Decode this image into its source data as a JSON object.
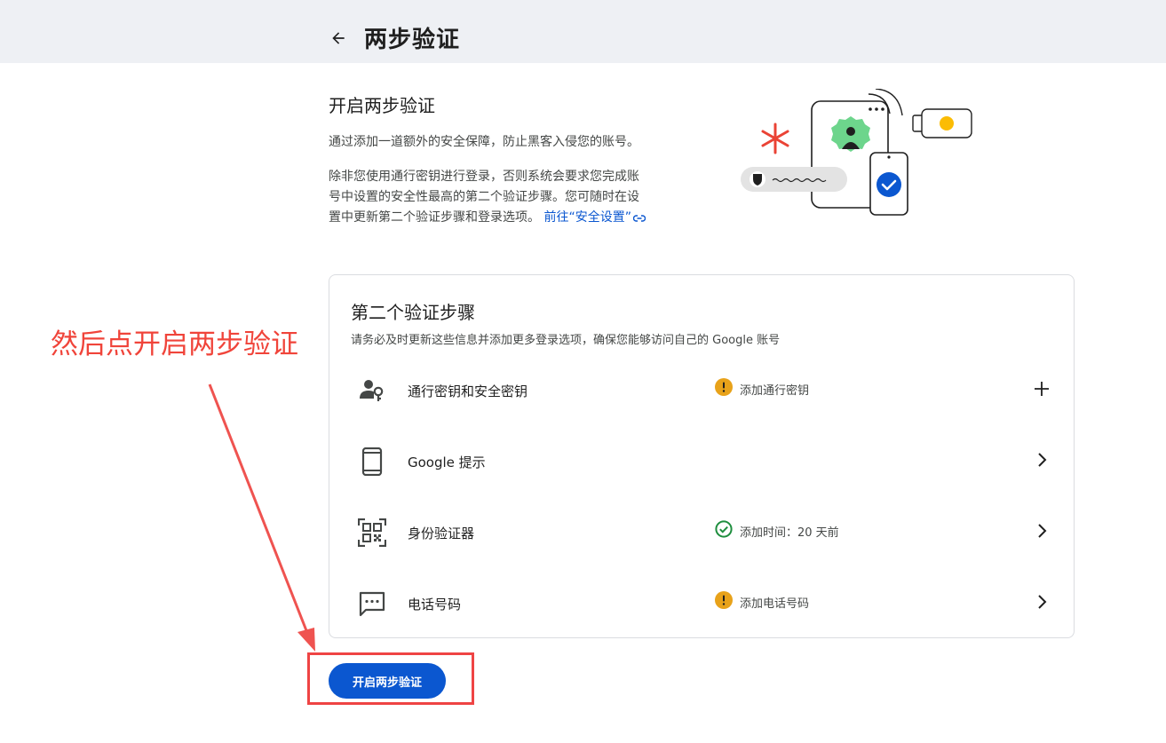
{
  "header": {
    "title": "两步验证"
  },
  "intro": {
    "title": "开启两步验证",
    "paragraph1": "通过添加一道额外的安全保障，防止黑客入侵您的账号。",
    "paragraph2_line1": "除非您使用通行密钥进行登录，否则系统会要求您完成账",
    "paragraph2_line2": "号中设置的安全性最高的第二个验证步骤。您可随时在设",
    "paragraph2_line3": "置中更新第二个验证步骤和登录选项。",
    "link_text": "前往“安全设置”"
  },
  "card": {
    "title": "第二个验证步骤",
    "subtitle": "请务必及时更新这些信息并添加更多登录选项，确保您能够访问自己的 Google 账号",
    "rows": [
      {
        "label": "通行密钥和安全密钥",
        "status": "添加通行密钥",
        "status_type": "warning",
        "icon": "passkey-person-key-icon",
        "action": "plus-icon"
      },
      {
        "label": "Google 提示",
        "status": "",
        "status_type": "none",
        "icon": "phone-icon",
        "action": "chevron-right-icon"
      },
      {
        "label": "身份验证器",
        "status": "添加时间：20 天前",
        "status_type": "success",
        "icon": "qr-code-icon",
        "action": "chevron-right-icon"
      },
      {
        "label": "电话号码",
        "status": "添加电话号码",
        "status_type": "warning",
        "icon": "sms-message-icon",
        "action": "chevron-right-icon"
      }
    ]
  },
  "annotation": {
    "text": "然后点开启两步验证"
  },
  "primary_button": {
    "label": "开启两步验证"
  },
  "colors": {
    "brand_blue": "#0b57d0",
    "warning": "#e8a21a",
    "success": "#1e8e3e",
    "annotation_red": "#f0443a"
  }
}
